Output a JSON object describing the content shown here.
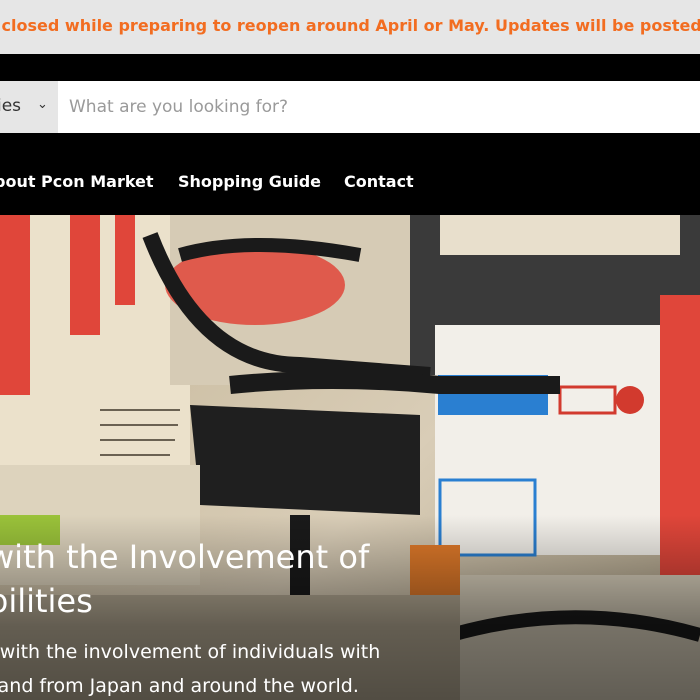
{
  "announcement": {
    "text": "rarily closed while preparing to reopen around April or May. Updates will be posted here.A"
  },
  "search": {
    "category_label": "ries",
    "placeholder": "What are you looking for?"
  },
  "nav": {
    "items": [
      {
        "label": "bout Pcon Market"
      },
      {
        "label": "Shopping Guide"
      },
      {
        "label": "Contact"
      }
    ]
  },
  "hero": {
    "title_line1": "with the Involvement of",
    "title_line2": "bilities",
    "subtitle_line1": "ed with the involvement of individuals with",
    "subtitle_line2": "es and from Japan and around the world.",
    "colors": {
      "bag_red": "#e0463a",
      "bag_blue": "#2a7fd1",
      "bag_cream": "#ece3cf",
      "strap_black": "#1a1a1a",
      "logo_red": "#d23a2e"
    }
  },
  "colors": {
    "accent_orange": "#f26d21",
    "announce_bg": "#e6e6e6",
    "nav_bg": "#000000"
  }
}
